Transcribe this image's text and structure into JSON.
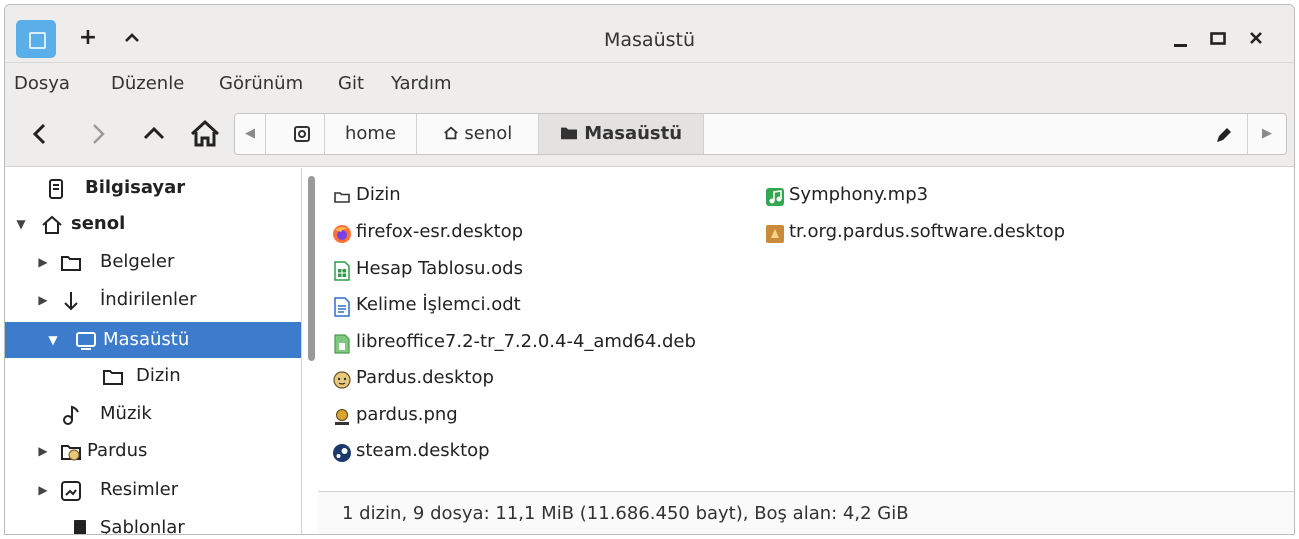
{
  "window": {
    "title": "Masaüstü",
    "title_buttons": {
      "new": "+",
      "up": "^"
    },
    "controls": {
      "minimize": "_",
      "maximize": "□",
      "close": "×"
    }
  },
  "menubar": {
    "items": [
      "Dosya",
      "Düzenle",
      "Görünüm",
      "Git",
      "Yardım"
    ]
  },
  "toolbar": {
    "path_segments": [
      {
        "label": "home",
        "icon": ""
      },
      {
        "label": "senol",
        "icon": "home-icon"
      },
      {
        "label": "Masaüstü",
        "icon": "folder-icon",
        "active": true
      }
    ]
  },
  "sidebar": {
    "items": [
      {
        "label": "Bilgisayar",
        "icon": "computer-icon",
        "bold": true,
        "expander": ""
      },
      {
        "label": "senol",
        "icon": "home-icon",
        "bold": true,
        "expander": "▼"
      },
      {
        "label": "Belgeler",
        "icon": "folder-icon",
        "expander": "▶"
      },
      {
        "label": "İndirilenler",
        "icon": "download-icon",
        "expander": "▶"
      },
      {
        "label": "Masaüstü",
        "icon": "desktop-icon",
        "expander": "▼",
        "selected": true
      },
      {
        "label": "Dizin",
        "icon": "folder-icon",
        "expander": ""
      },
      {
        "label": "Müzik",
        "icon": "music-icon",
        "expander": ""
      },
      {
        "label": "Pardus",
        "icon": "pardus-folder-icon",
        "expander": "▶"
      },
      {
        "label": "Resimler",
        "icon": "pictures-icon",
        "expander": "▶"
      },
      {
        "label": "Şablonlar",
        "icon": "templates-icon",
        "expander": ""
      }
    ]
  },
  "files": {
    "column1": [
      {
        "name": "Dizin",
        "icon": "folder-icon"
      },
      {
        "name": "firefox-esr.desktop",
        "icon": "firefox-icon"
      },
      {
        "name": "Hesap Tablosu.ods",
        "icon": "spreadsheet-icon"
      },
      {
        "name": "Kelime İşlemci.odt",
        "icon": "document-icon"
      },
      {
        "name": "libreoffice7.2-tr_7.2.0.4-4_amd64.deb",
        "icon": "package-icon"
      },
      {
        "name": "Pardus.desktop",
        "icon": "pardus-icon"
      },
      {
        "name": "pardus.png",
        "icon": "image-icon"
      },
      {
        "name": "steam.desktop",
        "icon": "steam-icon"
      }
    ],
    "column2": [
      {
        "name": "Symphony.mp3",
        "icon": "audio-icon"
      },
      {
        "name": "tr.org.pardus.software.desktop",
        "icon": "software-icon"
      }
    ]
  },
  "status": {
    "text": "1 dizin, 9 dosya: 11,1 MiB (11.686.450 bayt), Boş alan: 4,2 GiB"
  },
  "colors": {
    "selection": "#3d7ccd",
    "chrome": "#eeedeb",
    "app_icon": "#5aaeea"
  }
}
